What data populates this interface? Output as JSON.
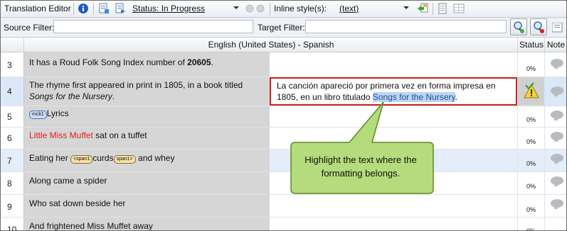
{
  "toolbar": {
    "title": "Translation Editor",
    "status_label": "Status: In Progress",
    "inline_styles_label": "Inline style(s):",
    "inline_styles_value": "(text)"
  },
  "filters": {
    "source_label": "Source Filter:",
    "target_label": "Target Filter:"
  },
  "grid": {
    "language_pair": "English (United States) - Spanish",
    "status_header": "Status",
    "notes_header": "Note"
  },
  "rows": [
    {
      "num": "3",
      "src_pre": "It has a Roud Folk Song Index number of ",
      "src_bold": "20605",
      "src_post": ".",
      "status": "0%"
    },
    {
      "num": "4",
      "src_l1": "The rhyme first appeared in print in 1805, in a book titled",
      "src_italic": "Songs for the Nursery",
      "src_post": ".",
      "tgt_l1": "La canción apareció por primera vez en forma impresa en",
      "tgt_l2_pre": "1805, en un libro titulado ",
      "tgt_highlight": "Songs for the Nursery",
      "tgt_post": "."
    },
    {
      "num": "5",
      "tag": "mck1",
      "src": "Lyrics",
      "status": "0%"
    },
    {
      "num": "6",
      "src_red": "Little Miss Muffet",
      "src_post": " sat on a tuffet",
      "status": "0%"
    },
    {
      "num": "7",
      "src_pre": "Eating her ",
      "tag1": "<span1",
      "src_mid": "curds",
      "tag2": "span1>",
      "src_post": " and whey",
      "status": "0%"
    },
    {
      "num": "8",
      "src": "Along came a spider",
      "status": "0%"
    },
    {
      "num": "9",
      "src": "Who sat down beside her",
      "status": "0%"
    },
    {
      "num": "10",
      "src": "And frightened Miss Muffet away",
      "status": "0%"
    }
  ],
  "callout": {
    "text": "Highlight the text where the formatting belongs."
  },
  "colors": {
    "accent_red": "#e0201b",
    "highlight": "#bcd5f2",
    "callout_fill": "#b4dc7c"
  }
}
